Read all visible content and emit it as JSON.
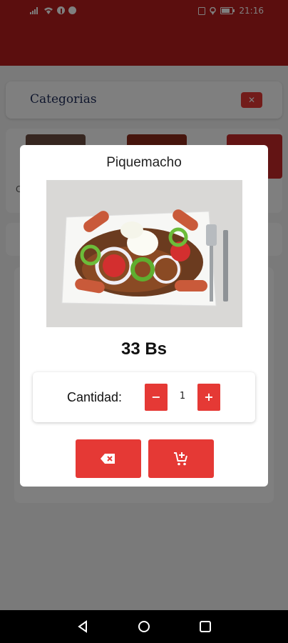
{
  "status_bar": {
    "time": "21:16"
  },
  "background": {
    "categories_title": "Categorias",
    "partial_label": "C"
  },
  "modal": {
    "title": "Piquemacho",
    "price": "33 Bs",
    "quantity_label": "Cantidad:",
    "quantity_value": "1",
    "decrement_label": "−",
    "increment_label": "+"
  },
  "colors": {
    "brand_red": "#e53935",
    "header_red": "#b71c1c"
  },
  "icons": {
    "cancel": "backspace-icon",
    "add_to_cart": "cart-add-icon",
    "nav": [
      "home-icon",
      "orders-icon",
      "cart-icon",
      "user-icon"
    ]
  }
}
